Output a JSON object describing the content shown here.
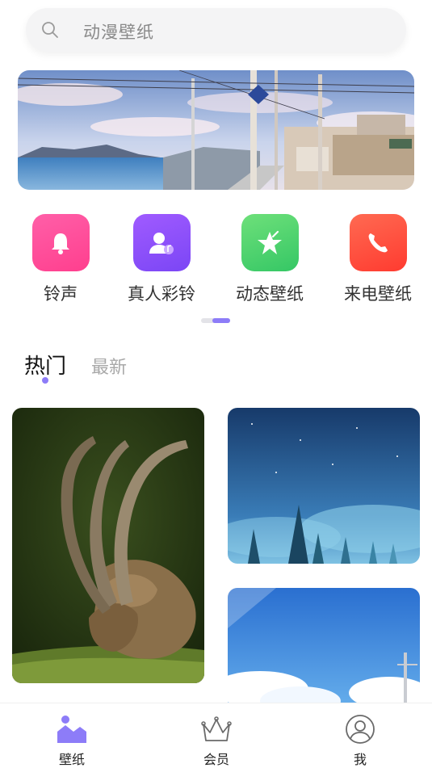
{
  "search": {
    "placeholder": "动漫壁纸",
    "icon": "search-icon"
  },
  "categories": [
    {
      "label": "铃声",
      "icon": "bell-icon",
      "color": "#ff4f9b"
    },
    {
      "label": "真人彩铃",
      "icon": "person-music-icon",
      "color": "#8b4ff7"
    },
    {
      "label": "动态壁纸",
      "icon": "star-icon",
      "color": "#45d06c"
    },
    {
      "label": "来电壁纸",
      "icon": "phone-icon",
      "color": "#ff4a3c"
    }
  ],
  "tabs": [
    {
      "label": "热门",
      "active": true
    },
    {
      "label": "最新",
      "active": false
    }
  ],
  "bottom_nav": [
    {
      "label": "壁纸",
      "icon": "mountain-image-icon",
      "active": true
    },
    {
      "label": "会员",
      "icon": "crown-icon",
      "active": false
    },
    {
      "label": "我",
      "icon": "user-icon",
      "active": false
    }
  ],
  "colors": {
    "accent": "#8d7cf8"
  }
}
